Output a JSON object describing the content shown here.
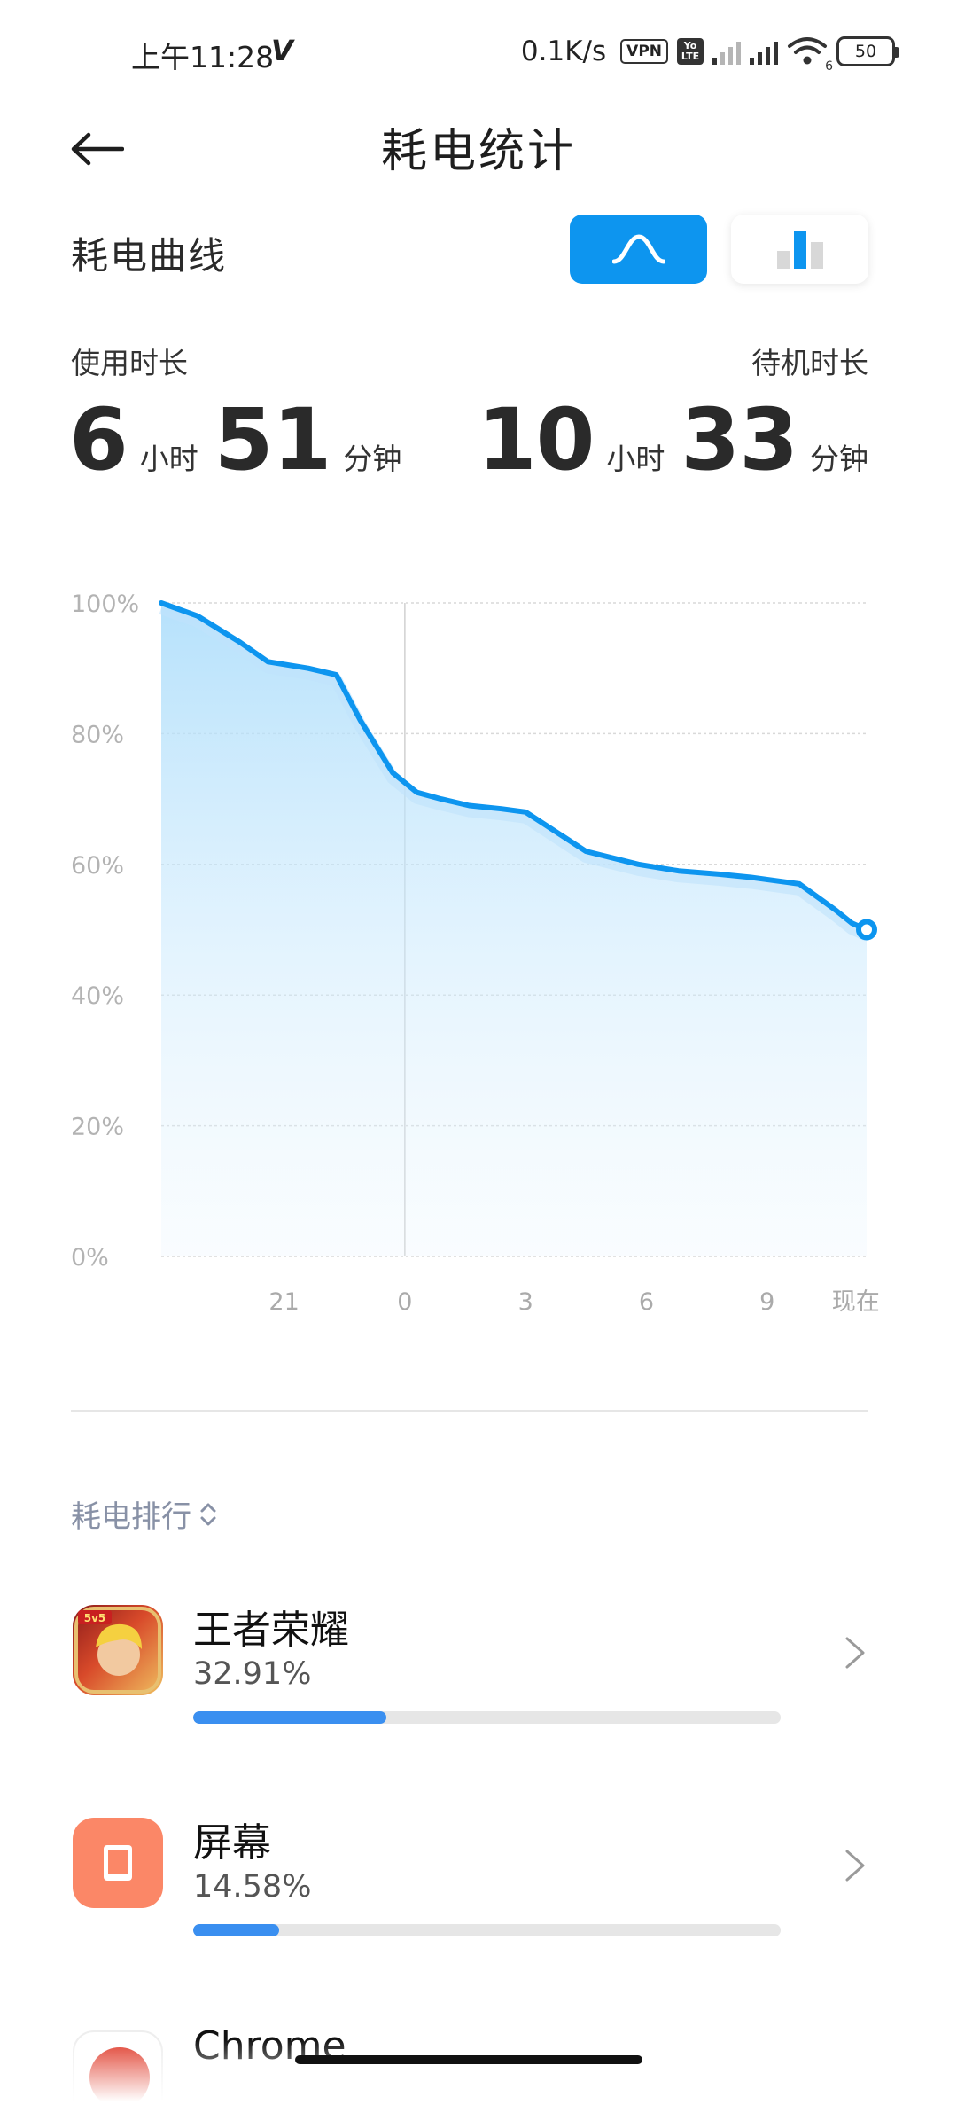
{
  "status": {
    "time": "上午11:28",
    "carrier_mark": "V",
    "net_speed": "0.1K/s",
    "vpn_label": "VPN",
    "volte_top": "Yo",
    "volte_bottom": "LTE",
    "wifi_sub": "6",
    "battery": "50"
  },
  "header": {
    "title": "耗电统计",
    "back_icon": "arrow-left-icon"
  },
  "section": {
    "title": "耗电曲线",
    "mode_curve_icon": "curve-icon",
    "mode_bar_icon": "bar-chart-icon",
    "active_mode": "curve",
    "accent_color": "#0d95ef"
  },
  "stats": {
    "usage_label": "使用时长",
    "usage_hours": "6",
    "usage_minutes": "51",
    "standby_label": "待机时长",
    "standby_hours": "10",
    "standby_minutes": "33",
    "hour_unit": "小时",
    "minute_unit": "分钟"
  },
  "chart_data": {
    "type": "area",
    "y_tick_labels": [
      "100%",
      "80%",
      "60%",
      "40%",
      "20%",
      "0%"
    ],
    "x_tick_labels": [
      "21",
      "0",
      "3",
      "6",
      "9",
      "现在"
    ],
    "ylim": [
      0,
      100
    ],
    "xlim": [
      -6.05,
      11.47
    ],
    "x_ticks": [
      -3,
      0,
      3,
      6,
      9,
      11.2
    ],
    "grid": "horizontal-dashed",
    "marker_line_x": 0,
    "x": [
      -6.05,
      -5.15,
      -4.1,
      -3.4,
      -2.4,
      -1.7,
      -1.1,
      -0.3,
      0.3,
      0.9,
      1.6,
      2.4,
      3.0,
      4.5,
      5.8,
      6.8,
      7.8,
      8.6,
      9.8,
      10.7,
      11.1,
      11.47
    ],
    "values": [
      100,
      98,
      94,
      91,
      90,
      89,
      82,
      74,
      71,
      70,
      69,
      68.5,
      68,
      62,
      60,
      59,
      58.5,
      58,
      57,
      53,
      51,
      50
    ],
    "line_color": "#0d95ef"
  },
  "ranking": {
    "title": "耗电排行",
    "sort_icon": "sort-updown-icon",
    "apps": [
      {
        "name": "王者荣耀",
        "percent": "32.91%",
        "fraction": 0.3291,
        "icon": "game-avatar-icon"
      },
      {
        "name": "屏幕",
        "percent": "14.58%",
        "fraction": 0.1458,
        "icon": "screen-icon",
        "icon_color": "#fb8767"
      },
      {
        "name": "Chrome",
        "percent": "",
        "fraction": 0,
        "icon": "chrome-icon"
      }
    ]
  }
}
